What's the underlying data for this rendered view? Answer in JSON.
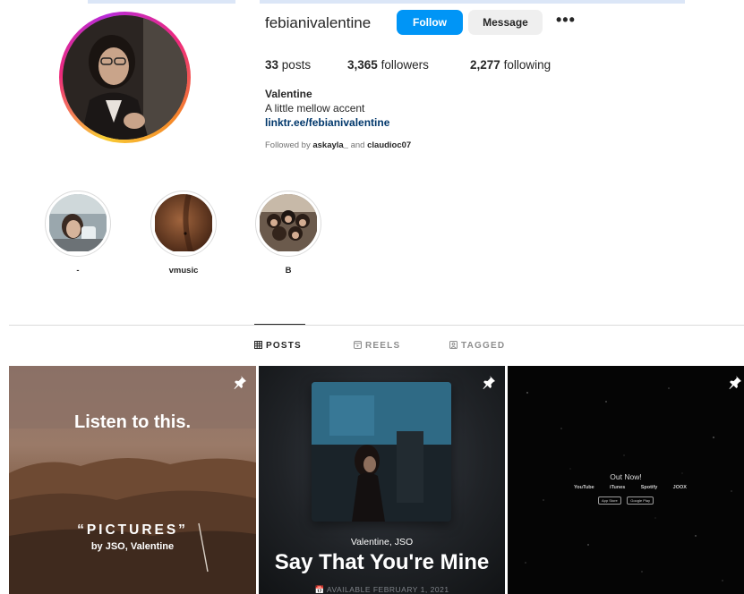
{
  "profile": {
    "username": "febianivalentine",
    "follow_label": "Follow",
    "message_label": "Message",
    "more_label": "•••",
    "stats": {
      "posts_count": "33",
      "posts_label": "posts",
      "followers_count": "3,365",
      "followers_label": "followers",
      "following_count": "2,277",
      "following_label": "following"
    },
    "full_name": "Valentine",
    "bio": "A little mellow accent",
    "link": "linktr.ee/febianivalentine",
    "followed_by": {
      "prefix": "Followed by",
      "user1": "askayla_",
      "joiner": "and",
      "user2": "claudioc07"
    }
  },
  "highlights": [
    {
      "label": "-"
    },
    {
      "label": "vmusic"
    },
    {
      "label": "B"
    }
  ],
  "tabs": [
    {
      "label": "POSTS",
      "icon": "grid-icon",
      "active": true
    },
    {
      "label": "REELS",
      "icon": "reels-icon",
      "active": false
    },
    {
      "label": "TAGGED",
      "icon": "tagged-icon",
      "active": false
    }
  ],
  "posts": [
    {
      "pinned": true,
      "headline": "Listen to this.",
      "song": "“PICTURES”",
      "byline": "by JSO, Valentine"
    },
    {
      "pinned": true,
      "artists": "Valentine, JSO",
      "title": "Say That You're Mine",
      "date": "AVAILABLE FEBRUARY 1, 2021"
    },
    {
      "pinned": true,
      "out_now": "Out Now!",
      "platforms": [
        "YouTube",
        "iTunes",
        "Spotify",
        "JOOX"
      ],
      "stores": [
        "App Store",
        "Google Play"
      ]
    }
  ],
  "colors": {
    "follow_blue": "#0095f6",
    "link_blue": "#00376b",
    "text": "#262626",
    "muted": "#737373"
  }
}
